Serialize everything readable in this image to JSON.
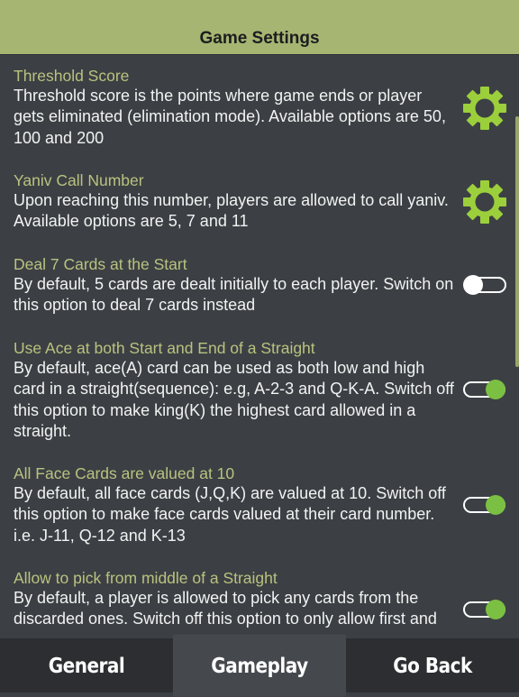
{
  "header": {
    "title": "Game Settings"
  },
  "colors": {
    "accent": "#a7b572",
    "gear": "#9ccf3c",
    "toggle_on": "#7bc043",
    "background": "#3c4044"
  },
  "settings": [
    {
      "title": "Threshold Score",
      "description": "Threshold score is the points where game ends or player gets eliminated (elimination mode). Available options are 50, 100 and 200",
      "control": "gear-icon"
    },
    {
      "title": "Yaniv Call Number",
      "description": "Upon reaching this number, players are allowed to call yaniv. Available options are 5, 7 and 11",
      "control": "gear-icon"
    },
    {
      "title": "Deal 7 Cards at the Start",
      "description": "By default, 5 cards are dealt initially to each player. Switch on this option to deal 7 cards instead",
      "control": "toggle",
      "on": false
    },
    {
      "title": "Use Ace at both Start and End of a Straight",
      "description": "By default, ace(A) card can be used as both low and high card in a straight(sequence): e.g, A-2-3 and Q-K-A. Switch off this option to make king(K) the highest card allowed in a straight.",
      "control": "toggle",
      "on": true
    },
    {
      "title": "All Face Cards are valued at 10",
      "description": "By default, all face cards (J,Q,K) are valued at 10. Switch off this option to make face cards valued at their card number. i.e. J-11, Q-12 and K-13",
      "control": "toggle",
      "on": true
    },
    {
      "title": "Allow to pick from middle of a Straight",
      "description": "By default, a player is allowed to pick any cards from the discarded ones. Switch off this option to only allow first and",
      "control": "toggle",
      "on": true
    }
  ],
  "tabs": [
    {
      "label": "General",
      "active": false
    },
    {
      "label": "Gameplay",
      "active": true
    },
    {
      "label": "Go Back",
      "active": false
    }
  ]
}
